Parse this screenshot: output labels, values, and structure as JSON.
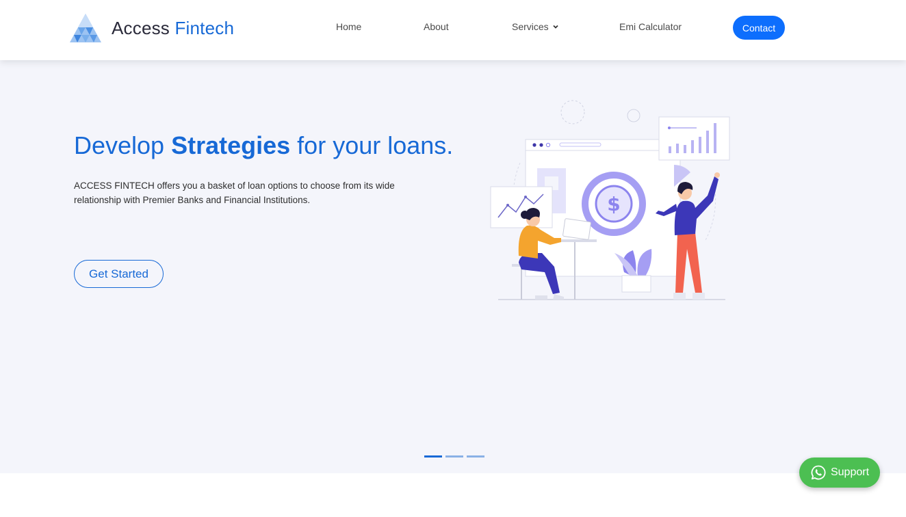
{
  "brand": {
    "name_part1": "Access",
    "name_part2": "Fintech"
  },
  "nav": {
    "home": "Home",
    "about": "About",
    "services": "Services",
    "emi": "Emi Calculator",
    "contact": "Contact"
  },
  "hero": {
    "title_pre": "Develop ",
    "title_bold": "Strategies",
    "title_post": " for your loans.",
    "description": "ACCESS FINTECH offers you a basket of loan options to choose from its wide relationship with Premier Banks and Financial Institutions.",
    "cta": "Get Started",
    "illustration_dollar": "$"
  },
  "carousel": {
    "slide_count": 3,
    "active_index": 0
  },
  "support": {
    "label": "Support",
    "icon": "whatsapp-icon"
  },
  "colors": {
    "primary": "#1769d6",
    "button": "#0d6efd",
    "hero_bg": "#f4f5fb",
    "support_green": "#4cbf52",
    "illustration_purple": "#8c84ee"
  }
}
